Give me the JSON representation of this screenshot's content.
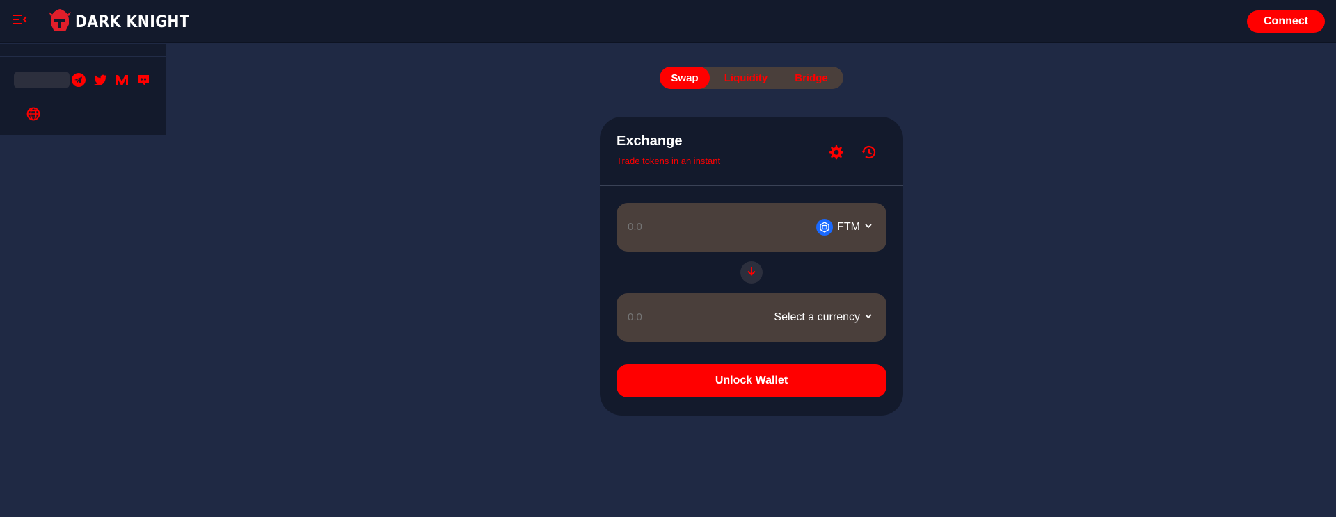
{
  "header": {
    "logo_text": "DARK KNIGHT",
    "connect_label": "Connect"
  },
  "sidebar": {
    "socials": [
      "telegram-icon",
      "twitter-icon",
      "medium-icon",
      "discord-icon"
    ],
    "language_icon": "globe-icon"
  },
  "tabs": [
    {
      "label": "Swap",
      "active": true
    },
    {
      "label": "Liquidity",
      "active": false
    },
    {
      "label": "Bridge",
      "active": false
    }
  ],
  "exchange": {
    "title": "Exchange",
    "subtitle": "Trade tokens in an instant",
    "from": {
      "placeholder": "0.0",
      "currency": "FTM"
    },
    "to": {
      "placeholder": "0.0",
      "currency": "Select a currency"
    },
    "unlock_label": "Unlock Wallet"
  },
  "colors": {
    "accent": "#ff0000",
    "background": "#1f2944",
    "panel": "#131a2c",
    "input_bg": "#4a3f3b"
  }
}
